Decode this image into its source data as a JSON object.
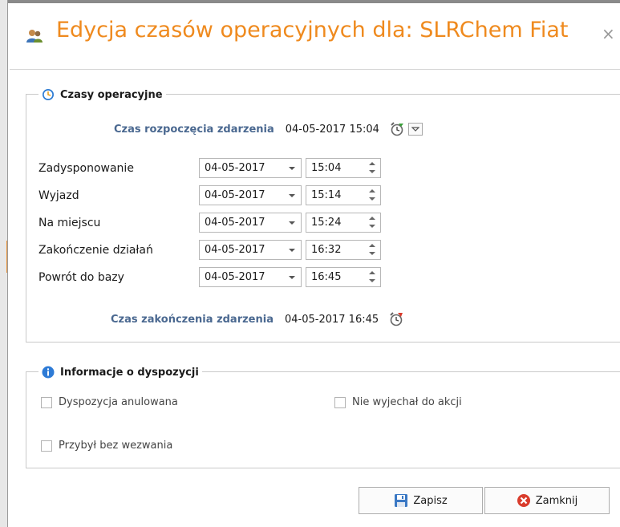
{
  "dialog": {
    "title": "Edycja czasów operacyjnych dla: SLRChem Fiat",
    "close_glyph": "×",
    "title_icon": "users-icon"
  },
  "operational_times": {
    "legend": "Czasy operacyjne",
    "legend_icon": "clock-icon",
    "start_label": "Czas rozpoczęcia zdarzenia",
    "start_value": "04-05-2017 15:04",
    "end_label": "Czas zakończenia zdarzenia",
    "end_value": "04-05-2017 16:45",
    "rows": [
      {
        "label": "Zadysponowanie",
        "date": "04-05-2017",
        "time": "15:04"
      },
      {
        "label": "Wyjazd",
        "date": "04-05-2017",
        "time": "15:14"
      },
      {
        "label": "Na miejscu",
        "date": "04-05-2017",
        "time": "15:24"
      },
      {
        "label": "Zakończenie działań",
        "date": "04-05-2017",
        "time": "16:32"
      },
      {
        "label": "Powrót do bazy",
        "date": "04-05-2017",
        "time": "16:45"
      }
    ]
  },
  "dispatch_info": {
    "legend": "Informacje o dyspozycji",
    "legend_icon": "info-icon",
    "checkboxes": [
      {
        "label": "Dyspozycja anulowana",
        "checked": false
      },
      {
        "label": "Nie wyjechał do akcji",
        "checked": false
      },
      {
        "label": "Przybył bez wezwania",
        "checked": false
      }
    ]
  },
  "buttons": {
    "save_label": "Zapisz",
    "close_label": "Zamknij"
  },
  "colors": {
    "title": "#ef8a1e",
    "label_blue": "#4a6890",
    "close_button_icon": "#d93c2c",
    "info_icon": "#2e7bd6"
  }
}
